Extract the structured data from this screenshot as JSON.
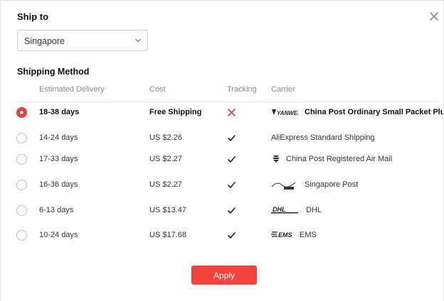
{
  "dialog": {
    "ship_to_label": "Ship to",
    "country_value": "Singapore",
    "shipping_method_label": "Shipping Method",
    "columns": {
      "delivery": "Estimated Delivery",
      "cost": "Cost",
      "tracking": "Tracking",
      "carrier": "Carrier"
    },
    "options": [
      {
        "delivery": "18-38 days",
        "cost": "Free Shipping",
        "tracking": false,
        "carrier": "China Post Ordinary Small Packet Plus",
        "logo": "yanwen-logo",
        "selected": true
      },
      {
        "delivery": "14-24 days",
        "cost": "US $2.26",
        "tracking": true,
        "carrier": "AliExpress Standard Shipping",
        "logo": "",
        "selected": false
      },
      {
        "delivery": "17-33 days",
        "cost": "US $2.27",
        "tracking": true,
        "carrier": "China Post Registered Air Mail",
        "logo": "china-post-logo",
        "selected": false
      },
      {
        "delivery": "16-36 days",
        "cost": "US $2.27",
        "tracking": true,
        "carrier": "Singapore Post",
        "logo": "singapore-post-logo",
        "selected": false
      },
      {
        "delivery": "6-13 days",
        "cost": "US $13.47",
        "tracking": true,
        "carrier": "DHL",
        "logo": "dhl-logo",
        "selected": false
      },
      {
        "delivery": "10-24 days",
        "cost": "US $17.68",
        "tracking": true,
        "carrier": "EMS",
        "logo": "ems-logo",
        "selected": false
      }
    ],
    "logo_text": {
      "yanwen": "YANWEN",
      "dhl": "DHL",
      "ems": "EMS"
    },
    "apply_label": "Apply",
    "colors": {
      "accent": "#f5413b",
      "cross": "#e0403a",
      "check": "#222222"
    }
  }
}
